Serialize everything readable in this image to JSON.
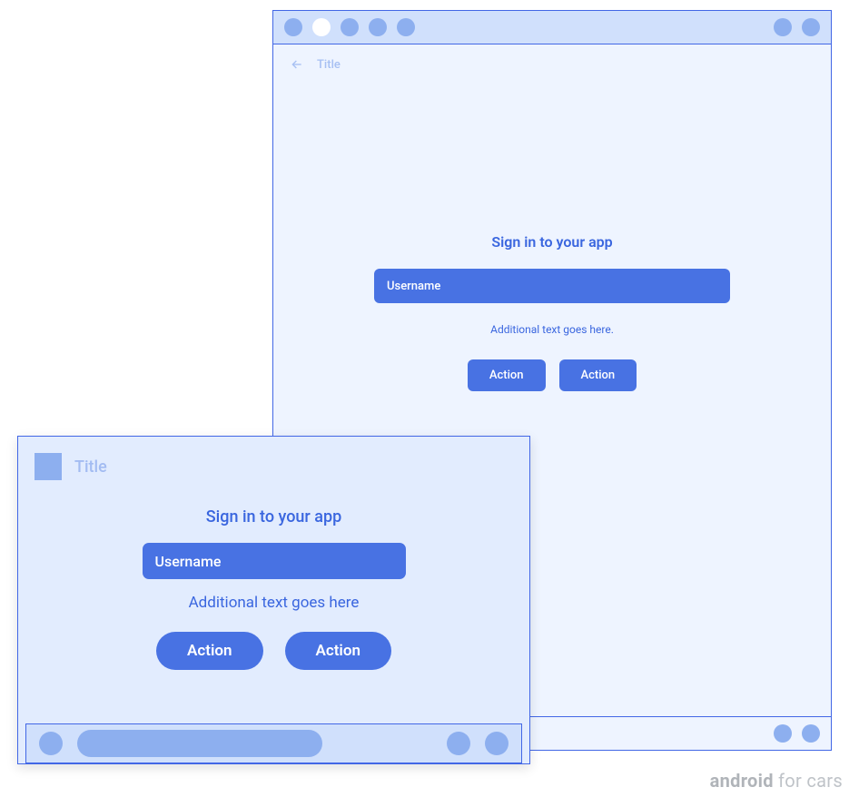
{
  "tablet": {
    "header_title": "Title",
    "signin": {
      "prompt": "Sign in to your app",
      "field_placeholder": "Username",
      "additional": "Additional text goes here.",
      "action1": "Action",
      "action2": "Action"
    }
  },
  "wide": {
    "header_title": "Title",
    "signin": {
      "prompt": "Sign in to your app",
      "field_placeholder": "Username",
      "additional": "Additional text goes here",
      "action1": "Action",
      "action2": "Action"
    }
  },
  "brand": {
    "bold": "android",
    "rest": " for cars"
  }
}
